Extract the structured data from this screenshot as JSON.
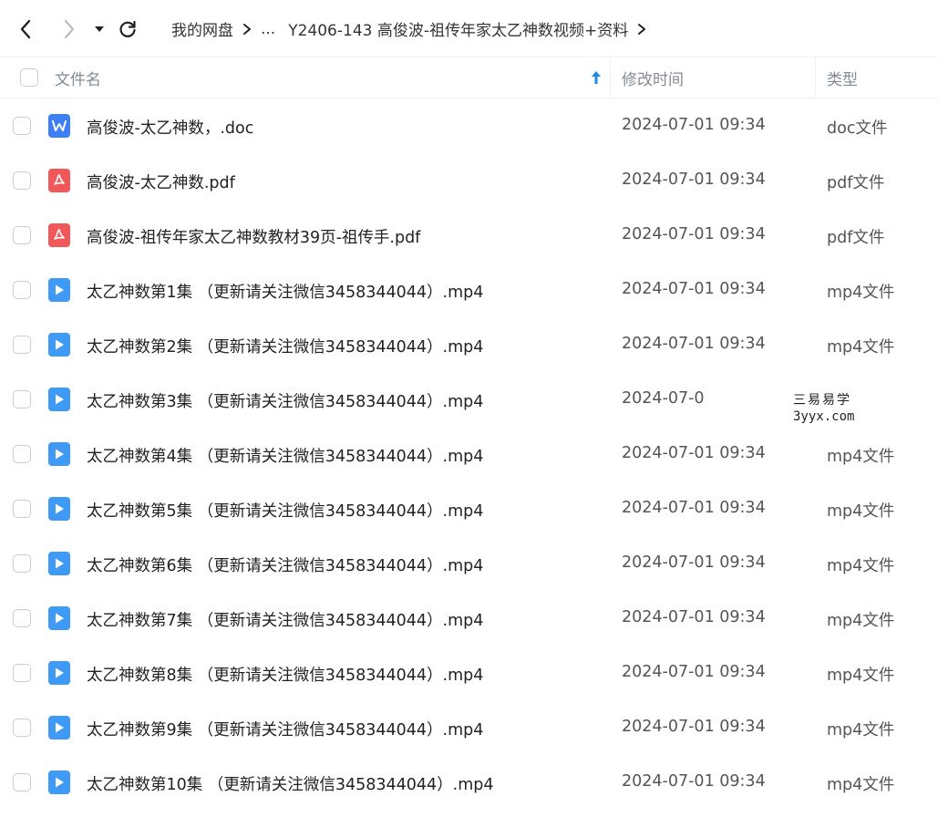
{
  "toolbar": {
    "back_icon": "chevron-left-icon",
    "forward_icon": "chevron-right-icon",
    "dropdown_icon": "caret-down-icon",
    "refresh_icon": "refresh-icon"
  },
  "breadcrumb": {
    "root": "我的网盘",
    "ellipsis": "...",
    "current": "Y2406-143 高俊波-祖传年家太乙神数视频+资料"
  },
  "columns": {
    "name": "文件名",
    "time": "修改时间",
    "type": "类型",
    "sort_icon": "sort-arrow-up-icon",
    "sort_color": "#1e88e5"
  },
  "colors": {
    "doc_icon": "#3d7ff6",
    "pdf_icon": "#f0585a",
    "video_icon": "#3f9af5"
  },
  "files": [
    {
      "name": "高俊波-太乙神数，.doc",
      "time": "2024-07-01 09:34",
      "type": "doc文件",
      "icon": "word-file-icon"
    },
    {
      "name": "高俊波-太乙神数.pdf",
      "time": "2024-07-01 09:34",
      "type": "pdf文件",
      "icon": "pdf-file-icon"
    },
    {
      "name": "高俊波-祖传年家太乙神数教材39页-祖传手.pdf",
      "time": "2024-07-01 09:34",
      "type": "pdf文件",
      "icon": "pdf-file-icon"
    },
    {
      "name": "太乙神数第1集 （更新请关注微信3458344044）.mp4",
      "time": "2024-07-01 09:34",
      "type": "mp4文件",
      "icon": "video-file-icon"
    },
    {
      "name": "太乙神数第2集 （更新请关注微信3458344044）.mp4",
      "time": "2024-07-01 09:34",
      "type": "mp4文件",
      "icon": "video-file-icon"
    },
    {
      "name": "太乙神数第3集 （更新请关注微信3458344044）.mp4",
      "time": "2024-07-0",
      "type": "",
      "icon": "video-file-icon"
    },
    {
      "name": "太乙神数第4集  （更新请关注微信3458344044）.mp4",
      "time": "2024-07-01 09:34",
      "type": "mp4文件",
      "icon": "video-file-icon"
    },
    {
      "name": "太乙神数第5集 （更新请关注微信3458344044）.mp4",
      "time": "2024-07-01 09:34",
      "type": "mp4文件",
      "icon": "video-file-icon"
    },
    {
      "name": "太乙神数第6集 （更新请关注微信3458344044）.mp4",
      "time": "2024-07-01 09:34",
      "type": "mp4文件",
      "icon": "video-file-icon"
    },
    {
      "name": "太乙神数第7集 （更新请关注微信3458344044）.mp4",
      "time": "2024-07-01 09:34",
      "type": "mp4文件",
      "icon": "video-file-icon"
    },
    {
      "name": "太乙神数第8集 （更新请关注微信3458344044）.mp4",
      "time": "2024-07-01 09:34",
      "type": "mp4文件",
      "icon": "video-file-icon"
    },
    {
      "name": "太乙神数第9集 （更新请关注微信3458344044）.mp4",
      "time": "2024-07-01 09:34",
      "type": "mp4文件",
      "icon": "video-file-icon"
    },
    {
      "name": "太乙神数第10集 （更新请关注微信3458344044）.mp4",
      "time": "2024-07-01 09:34",
      "type": "mp4文件",
      "icon": "video-file-icon"
    }
  ],
  "watermark": {
    "line1": "三易易学",
    "line2": "3yyx.com"
  }
}
